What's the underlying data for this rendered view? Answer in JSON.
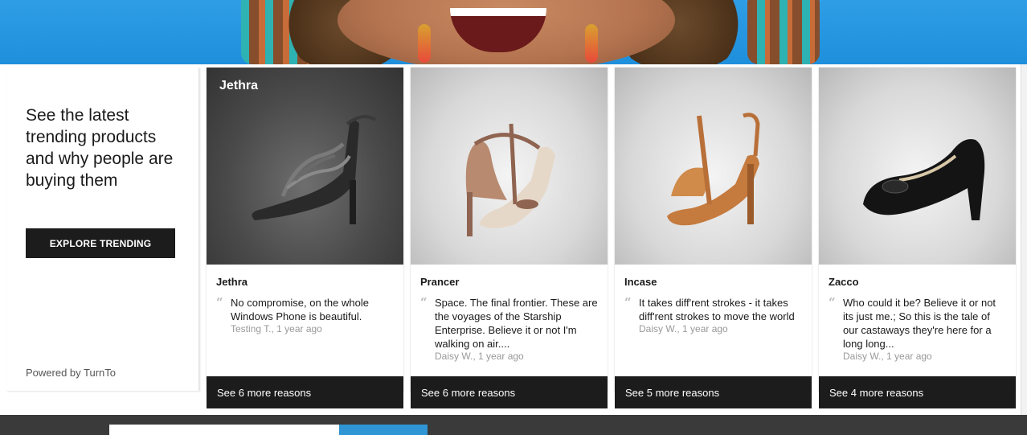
{
  "hero": {
    "image_icon": "hero-banner-photo"
  },
  "intro": {
    "heading": "See the latest trending products and why people are buying them",
    "explore_label": "EXPLORE TRENDING",
    "powered_by": "Powered by TurnTo"
  },
  "products": [
    {
      "overlay_title": "Jethra",
      "name": "Jethra",
      "quote": "No compromise, on the whole Windows Phone is beautiful.",
      "meta": "Testing T., 1 year ago",
      "more": "See 6 more reasons"
    },
    {
      "overlay_title": "",
      "name": "Prancer",
      "quote": "Space. The final frontier. These are the voyages of the Starship Enterprise. Believe it or not I'm walking on air....",
      "meta": "Daisy W., 1 year ago",
      "more": "See 6 more reasons"
    },
    {
      "overlay_title": "",
      "name": "Incase",
      "quote": "It takes diff'rent strokes - it takes diff'rent strokes to move the world",
      "meta": "Daisy W., 1 year ago",
      "more": "See 5 more reasons"
    },
    {
      "overlay_title": "",
      "name": "Zacco",
      "quote": "Who could it be? Believe it or not its just me.; So this is the tale of our castaways they're here for a long long...",
      "meta": "Daisy W., 1 year ago",
      "more": "See 4 more reasons"
    }
  ],
  "quote_glyph": "“",
  "colors": {
    "accent_blue": "#2f95d4",
    "footer_dark": "#1c1c1c",
    "bottom_bar": "#3a3a3a"
  }
}
